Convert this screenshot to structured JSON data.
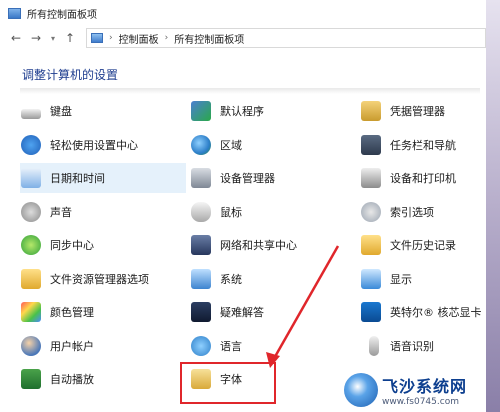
{
  "window": {
    "title": "所有控制面板项"
  },
  "address": {
    "crumbs": [
      "控制面板",
      "所有控制面板项"
    ]
  },
  "heading": "调整计算机的设置",
  "items": [
    [
      {
        "label": "键盘",
        "icon": "keyboard-icon"
      },
      {
        "label": "默认程序",
        "icon": "default-programs-icon"
      },
      {
        "label": "凭据管理器",
        "icon": "credential-manager-icon"
      }
    ],
    [
      {
        "label": "轻松使用设置中心",
        "icon": "ease-of-access-icon"
      },
      {
        "label": "区域",
        "icon": "region-icon"
      },
      {
        "label": "任务栏和导航",
        "icon": "taskbar-icon"
      }
    ],
    [
      {
        "label": "日期和时间",
        "icon": "date-time-icon"
      },
      {
        "label": "设备管理器",
        "icon": "device-manager-icon"
      },
      {
        "label": "设备和打印机",
        "icon": "devices-printers-icon"
      }
    ],
    [
      {
        "label": "声音",
        "icon": "sound-icon"
      },
      {
        "label": "鼠标",
        "icon": "mouse-icon"
      },
      {
        "label": "索引选项",
        "icon": "indexing-options-icon"
      }
    ],
    [
      {
        "label": "同步中心",
        "icon": "sync-center-icon"
      },
      {
        "label": "网络和共享中心",
        "icon": "network-sharing-icon"
      },
      {
        "label": "文件历史记录",
        "icon": "file-history-icon"
      }
    ],
    [
      {
        "label": "文件资源管理器选项",
        "icon": "file-explorer-options-icon"
      },
      {
        "label": "系统",
        "icon": "system-icon"
      },
      {
        "label": "显示",
        "icon": "display-icon"
      }
    ],
    [
      {
        "label": "颜色管理",
        "icon": "color-management-icon"
      },
      {
        "label": "疑难解答",
        "icon": "troubleshooting-icon"
      },
      {
        "label": "英特尔® 核芯显卡",
        "icon": "intel-graphics-icon"
      }
    ],
    [
      {
        "label": "用户帐户",
        "icon": "user-accounts-icon"
      },
      {
        "label": "语言",
        "icon": "language-icon"
      },
      {
        "label": "语音识别",
        "icon": "speech-recognition-icon"
      }
    ],
    [
      {
        "label": "自动播放",
        "icon": "autoplay-icon"
      },
      {
        "label": "字体",
        "icon": "fonts-icon"
      },
      {
        "label": "",
        "icon": ""
      }
    ]
  ],
  "highlight_color": "#e5f1fb",
  "annotation_color": "#e0262b",
  "watermark": {
    "title": "飞沙系统网",
    "url": "www.fs0745.com"
  }
}
